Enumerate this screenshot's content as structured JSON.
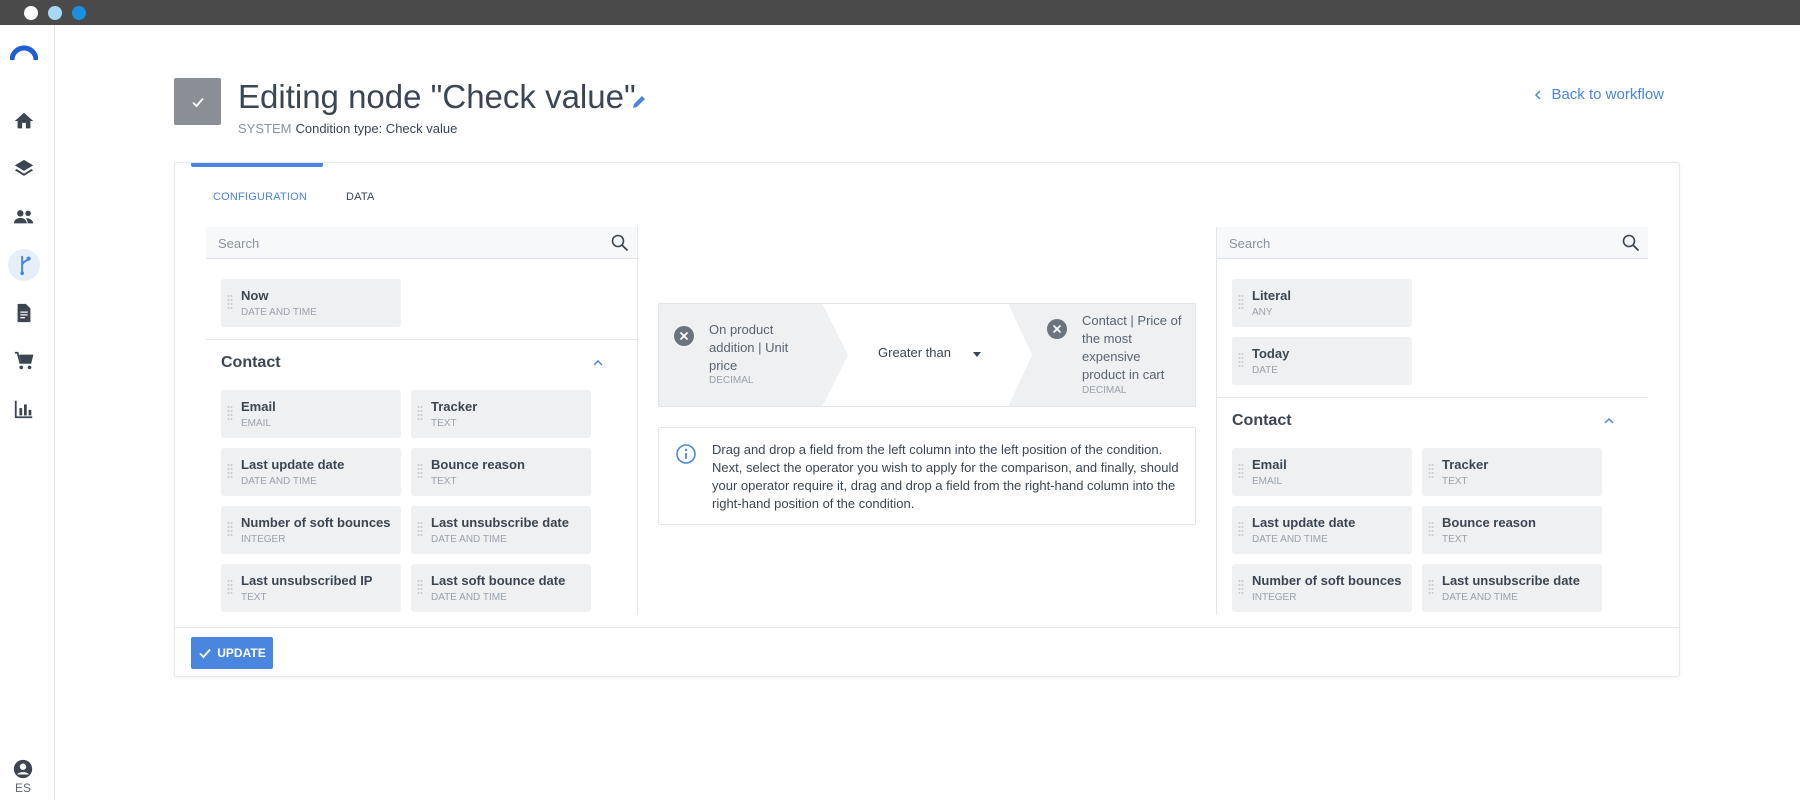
{
  "window": {
    "dot_colors": [
      "#ffffff",
      "#a8d8f5",
      "#1a8fe0"
    ]
  },
  "sidebar": {
    "items": [
      {
        "name": "home-icon"
      },
      {
        "name": "layers-icon"
      },
      {
        "name": "contacts-icon"
      },
      {
        "name": "workflow-icon",
        "active": true
      },
      {
        "name": "document-icon"
      },
      {
        "name": "cart-icon"
      },
      {
        "name": "reports-icon"
      }
    ],
    "user_lang": "ES"
  },
  "header": {
    "title": "Editing node \"Check value\"",
    "subtitle_prefix": "SYSTEM",
    "subtitle": "Condition type: Check value",
    "back_link": "Back to workflow"
  },
  "tabs": {
    "configuration": "CONFIGURATION",
    "data": "DATA"
  },
  "left_panel": {
    "search_placeholder": "Search",
    "top_fields": [
      {
        "name": "Now",
        "type": "DATE AND TIME"
      }
    ],
    "section_title": "Contact",
    "fields": [
      {
        "name": "Email",
        "type": "EMAIL"
      },
      {
        "name": "Tracker",
        "type": "TEXT"
      },
      {
        "name": "Last update date",
        "type": "DATE AND TIME"
      },
      {
        "name": "Bounce reason",
        "type": "TEXT"
      },
      {
        "name": "Number of soft bounces",
        "type": "INTEGER"
      },
      {
        "name": "Last unsubscribe date",
        "type": "DATE AND TIME"
      },
      {
        "name": "Last unsubscribed IP",
        "type": "TEXT"
      },
      {
        "name": "Last soft bounce date",
        "type": "DATE AND TIME"
      }
    ]
  },
  "condition": {
    "left_field": {
      "line1": "On product",
      "line2": "addition | Unit",
      "line3": "price",
      "type": "DECIMAL"
    },
    "operator": "Greater than",
    "right_field": {
      "line1": "Contact | Price of",
      "line2": "the most",
      "line3": "expensive",
      "line4": "product in cart",
      "type": "DECIMAL"
    },
    "info": "Drag and drop a field from the left column into the left position of the condition. Next, select the operator you wish to apply for the comparison, and finally, should your operator require it, drag and drop a field from the right-hand column into the right-hand position of the condition."
  },
  "right_panel": {
    "search_placeholder": "Search",
    "top_fields": [
      {
        "name": "Literal",
        "type": "ANY"
      },
      {
        "name": "Today",
        "type": "DATE"
      }
    ],
    "section_title": "Contact",
    "fields": [
      {
        "name": "Email",
        "type": "EMAIL"
      },
      {
        "name": "Tracker",
        "type": "TEXT"
      },
      {
        "name": "Last update date",
        "type": "DATE AND TIME"
      },
      {
        "name": "Bounce reason",
        "type": "TEXT"
      },
      {
        "name": "Number of soft bounces",
        "type": "INTEGER"
      },
      {
        "name": "Last unsubscribe date",
        "type": "DATE AND TIME"
      }
    ]
  },
  "footer": {
    "update_label": "UPDATE"
  },
  "colors": {
    "accent": "#4a86e0",
    "text": "#3c4652",
    "chip_bg": "#eef0f2"
  }
}
